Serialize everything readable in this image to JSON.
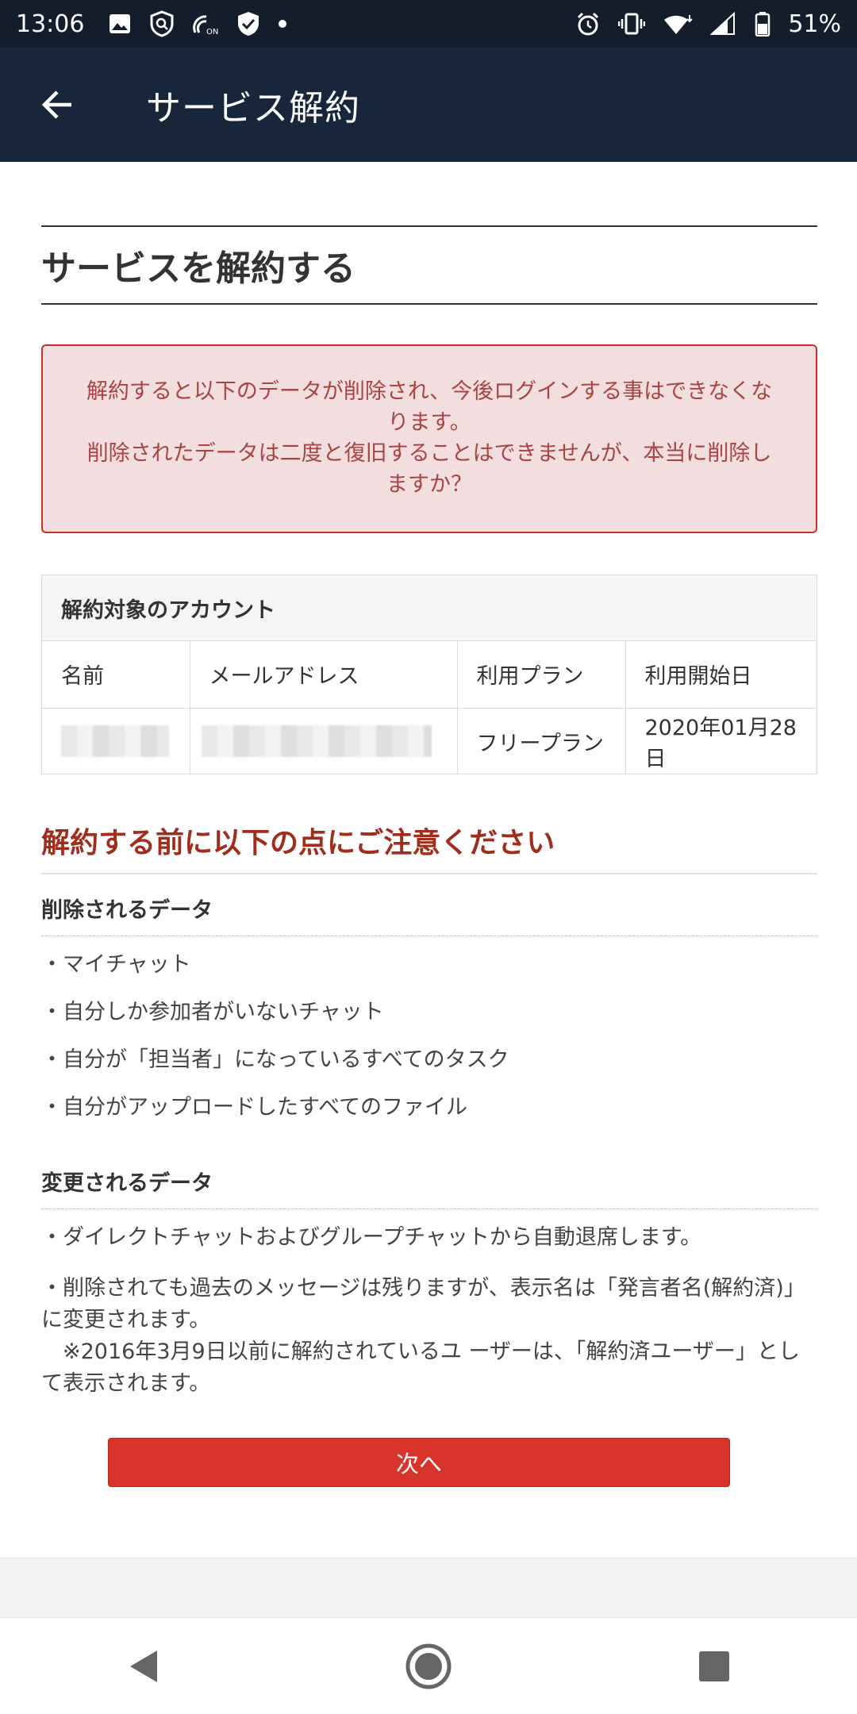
{
  "status_bar": {
    "time": "13:06",
    "battery": "51%",
    "left_icons": [
      "image-icon",
      "search-shield-icon",
      "nfc-on-icon",
      "shield-check-icon",
      "dot-icon"
    ],
    "right_icons": [
      "alarm-icon",
      "vibrate-icon",
      "wifi-icon",
      "signal-icon",
      "battery-icon"
    ]
  },
  "app_bar": {
    "title": "サービス解約"
  },
  "page": {
    "heading": "サービスを解約する",
    "alert": {
      "line1": "解約すると以下のデータが削除され、今後ログインする事はできなくなります。",
      "line2": "削除されたデータは二度と復旧することはできませんが、本当に削除しますか？"
    },
    "account": {
      "title": "解約対象のアカウント",
      "columns": [
        "名前",
        "メールアドレス",
        "利用プラン",
        "利用開始日"
      ],
      "row": {
        "plan": "フリープラン",
        "start_date": "2020年01月28日"
      }
    },
    "notice_title": "解約する前に以下の点にご注意ください",
    "deleted": {
      "title": "削除されるデータ",
      "items": [
        "・マイチャット",
        "・自分しか参加者がいないチャット",
        "・自分が「担当者」になっているすべてのタスク",
        "・自分がアップロードしたすべてのファイル"
      ]
    },
    "changed": {
      "title": "変更されるデータ",
      "item1": "・ダイレクトチャットおよびグループチャットから自動退席します。",
      "item2": "・削除されても過去のメッセージは残りますが、表示名は「発言者名(解約済)」に変更されます。",
      "note": "　※2016年3月9日以前に解約されているユ ーザーは、「解約済ユーザー」として表示されます。"
    },
    "next_button": "次へ"
  },
  "colors": {
    "app_bar": "#17263a",
    "alert_bg": "#f2dede",
    "alert_text": "#a94442",
    "notice_title": "#a12d1d",
    "button": "#d9342b"
  }
}
